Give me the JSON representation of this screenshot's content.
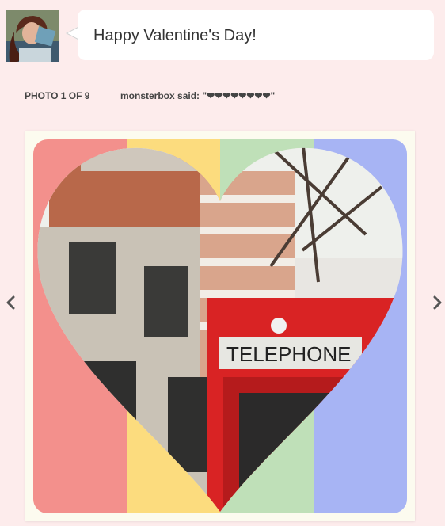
{
  "post": {
    "message": "Happy Valentine's Day!",
    "photo_counter": "PHOTO 1 OF 9",
    "author": "monsterbox",
    "said_label": "said:",
    "caption": "\"❤❤❤❤❤❤❤❤\""
  },
  "stripes": [
    "#f3908c",
    "#fcdc7e",
    "#bfe0b8",
    "#a7b4f4"
  ],
  "photo_sign": "TELEPHONE",
  "icons": {
    "prev": "chevron-left-icon",
    "next": "chevron-right-icon"
  }
}
